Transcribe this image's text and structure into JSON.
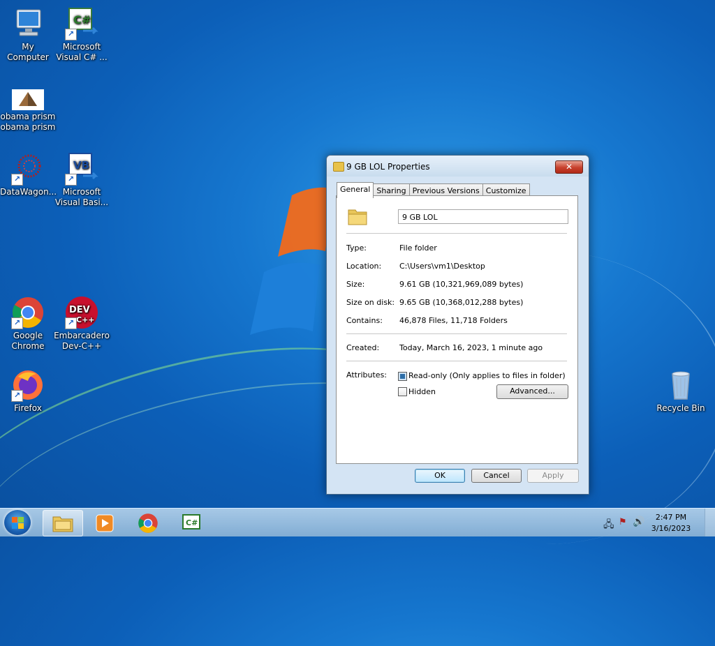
{
  "desktop": {
    "icons": [
      {
        "label": "My Computer"
      },
      {
        "label": "Microsoft Visual C# ..."
      },
      {
        "label": "obama prism obama prism"
      },
      {
        "label": "DataWagon..."
      },
      {
        "label": "Microsoft Visual Basi..."
      },
      {
        "label": "Google Chrome"
      },
      {
        "label": "Embarcadero Dev-C++"
      },
      {
        "label": "Firefox"
      },
      {
        "label": "Recycle Bin"
      }
    ],
    "dev_badge_top": "DEV",
    "dev_badge_bottom": "C++",
    "cs_badge": "C#",
    "vb_badge": "VB"
  },
  "dialog": {
    "title": "9 GB LOL Properties",
    "close_label": "✕",
    "tabs": [
      "General",
      "Sharing",
      "Previous Versions",
      "Customize"
    ],
    "active_tab": "General",
    "name_value": "9 GB LOL",
    "fields": [
      {
        "label": "Type:",
        "value": "File folder"
      },
      {
        "label": "Location:",
        "value": "C:\\Users\\vm1\\Desktop"
      },
      {
        "label": "Size:",
        "value": "9.61 GB (10,321,969,089 bytes)"
      },
      {
        "label": "Size on disk:",
        "value": "9.65 GB (10,368,012,288 bytes)"
      },
      {
        "label": "Contains:",
        "value": "46,878 Files, 11,718 Folders"
      }
    ],
    "created": {
      "label": "Created:",
      "value": "Today, March 16, 2023, 1 minute ago"
    },
    "attributes": {
      "label": "Attributes:",
      "readonly_label": "Read-only (Only applies to files in folder)",
      "readonly_checked": true,
      "hidden_label": "Hidden",
      "hidden_checked": false,
      "advanced_label": "Advanced..."
    },
    "buttons": {
      "ok": "OK",
      "cancel": "Cancel",
      "apply": "Apply"
    }
  },
  "taskbar": {
    "items": [
      "Windows Explorer",
      "Windows Media Player",
      "Google Chrome",
      "Microsoft Visual C#"
    ],
    "active_item": "Windows Explorer",
    "cs_label": "C#",
    "clock_time": "2:47 PM",
    "clock_date": "3/16/2023"
  },
  "colors": {
    "dialog_bg": "#d4e4f4",
    "close_red": "#c7402c",
    "desktop_blue": "#1677cf"
  }
}
